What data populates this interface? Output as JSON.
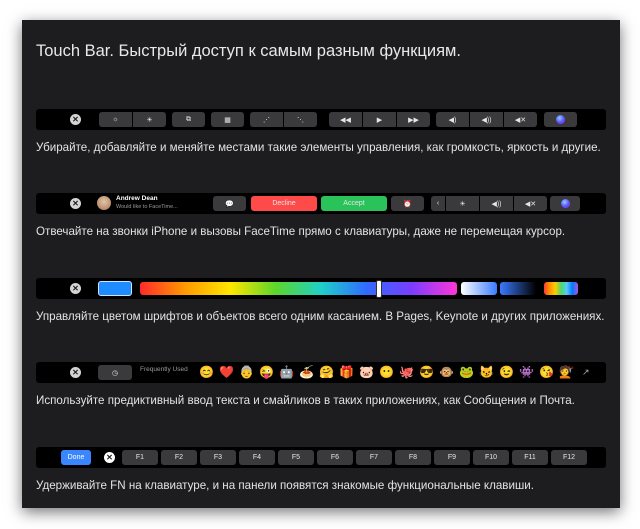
{
  "title": "Touch Bar. Быстрый доступ к самым разным функциям.",
  "captions": [
    "Убирайте, добавляйте и меняйте местами такие элементы управления, как громкость, яркость и другие.",
    "Отвечайте на звонки iPhone и вызовы FaceTime прямо с клавиатуры, даже не перемещая курсор.",
    "Управляйте цветом шрифтов и объектов всего одним касанием. В Pages, Keynote и других приложениях.",
    "Используйте предиктивный ввод текста и смайликов в таких приложениях, как Сообщения и Почта.",
    "Удерживайте FN на клавиатуре, и на панели появятся знакомые функциональные клавиши."
  ],
  "close_glyph": "✕",
  "bar1": {
    "keys": [
      "☼",
      "☀",
      "⧉",
      "▦",
      "⋰",
      "⋱",
      "◀◀",
      "▶",
      "▶▶",
      "◀)",
      "◀))",
      "◀✕"
    ]
  },
  "bar2": {
    "caller_name": "Andrew Dean",
    "caller_sub": "Would like to FaceTime...",
    "message_glyph": "💬",
    "decline_label": "Decline",
    "accept_label": "Accept",
    "alarm_glyph": "⏰",
    "chevron": "‹",
    "brightness_glyph": "☀",
    "vol_glyph": "◀))",
    "mute_glyph": "◀✕",
    "accent_decline": "#ff4a4a",
    "accent_accept": "#29c35a"
  },
  "bar3": {
    "swatch_color": "#1e8bff"
  },
  "bar4": {
    "recent_glyph": "◷",
    "frequently_used": "Frequently Used",
    "emojis": [
      "😊",
      "❤️",
      "👵",
      "😜",
      "🤖",
      "🍝",
      "🤗",
      "🎁",
      "🐷",
      "😶",
      "🐙",
      "😎",
      "🐵",
      "🐸",
      "😼",
      "😉",
      "👾",
      "😘",
      "💇",
      "↗"
    ]
  },
  "bar5": {
    "done_label": "Done",
    "fkeys": [
      "F1",
      "F2",
      "F3",
      "F4",
      "F5",
      "F6",
      "F7",
      "F8",
      "F9",
      "F10",
      "F11",
      "F12"
    ]
  }
}
